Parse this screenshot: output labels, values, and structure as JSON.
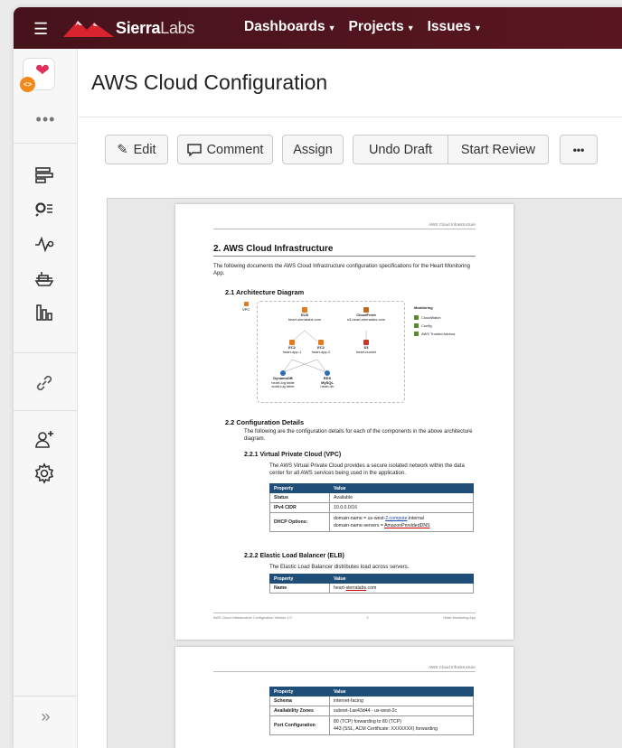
{
  "topbar": {
    "brand_bold": "Sierra",
    "brand_light": "Labs",
    "nav": [
      {
        "label": "Dashboards"
      },
      {
        "label": "Projects"
      },
      {
        "label": "Issues"
      }
    ],
    "background": "#4b141c"
  },
  "sidebar": {
    "more": "•••",
    "collapse": "»"
  },
  "page": {
    "title": "AWS Cloud Configuration"
  },
  "toolbar": {
    "edit": "Edit",
    "comment": "Comment",
    "assign": "Assign",
    "undo_draft": "Undo Draft",
    "start_review": "Start Review",
    "more": "•••"
  },
  "doc": {
    "running_header": "AWS Cloud Infrastructure",
    "section_title": "2.  AWS Cloud Infrastructure",
    "intro": "The following documents the AWS Cloud Infrastructure configuration specifications for the Heart Monitoring App.",
    "s21": "2.1    Architecture Diagram",
    "diagram": {
      "vpc": "VPC",
      "elb": "ELB",
      "elb_sub": "heart-sierralabs.com",
      "cloudfront": "CloudFront",
      "cloudfront_sub": "s3-heart-sierralabs.com",
      "ec2a": "EC2",
      "ec2a_sub": "heart-app-1",
      "ec2b": "EC2",
      "ec2b_sub": "heart-app-2",
      "s3": "S3",
      "s3_sub": "heart-bucket",
      "dynamo": "DynamoDB",
      "dynamo_sub1": "heart-log table",
      "dynamo_sub2": "audit-log table",
      "rds": "RDS",
      "rds_sub1": "MySQL",
      "rds_sub2": "heart-db",
      "monitoring": "Monitoring",
      "legend": [
        "CloudWatch",
        "Config",
        "AWS Trusted Advisor"
      ]
    },
    "s22": "2.2    Configuration Details",
    "s22_text": "The following are the configuration details for each of the components in the above architecture diagram.",
    "s221": "2.2.1    Virtual Private Cloud (VPC)",
    "s221_text": "The AWS Virtual Private Cloud provides a secure isolated network within the data center for all AWS services being used in the application.",
    "vpc_table": {
      "headers": [
        "Property",
        "Value"
      ],
      "status_k": "Status",
      "status_v": "Available",
      "cidr_k": "IPv4 CIDR",
      "cidr_v": "10.0.0.0/16",
      "dhcp_k": "DHCP Options:",
      "dhcp_v1a": "domain-name = us-west-",
      "dhcp_v1b": "2.compute",
      "dhcp_v1c": ".internal",
      "dhcp_v2a": "domain-name-servers = ",
      "dhcp_v2b": "AmazonProvidedDNS"
    },
    "s222": "2.2.2    Elastic Load Balancer (ELB)",
    "s222_text": "The Elastic Load Balancer distributes load across servers.",
    "elb_table": {
      "headers": [
        "Property",
        "Value"
      ],
      "name_k": "Name",
      "name_va": "heart-",
      "name_vb": "sierralabs",
      "name_vc": ".com"
    },
    "footer_left": "AWS Cloud Infrastructure Configuration Version 1.0",
    "footer_mid": "3",
    "footer_right": "Heart Monitoring App",
    "page2_table": {
      "headers": [
        "Property",
        "Value"
      ],
      "schema_k": "Schema",
      "schema_v": "internet-facing",
      "az_k": "Availability Zones",
      "az_v": "subnet-1ae43d44 - us-west-2c",
      "port_k": "Port Configuration",
      "port_v1": "80 (TCP) forwarding to 80 (TCP)",
      "port_v2": "443 (SSL, ACM Certificate: XXXXXXX) forwarding"
    }
  }
}
